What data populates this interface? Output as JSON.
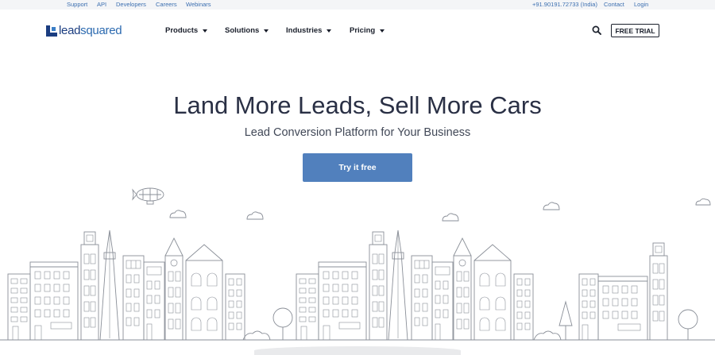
{
  "topbar": {
    "links_left": [
      "Support",
      "API",
      "Developers",
      "Careers",
      "Webinars"
    ],
    "phone": "+91.90191.72733 (India)",
    "contact": "Contact",
    "login": "Login"
  },
  "brand": {
    "name_part1": "lead",
    "name_part2": "squared"
  },
  "nav": {
    "items": [
      {
        "label": "Products"
      },
      {
        "label": "Solutions"
      },
      {
        "label": "Industries"
      },
      {
        "label": "Pricing"
      }
    ],
    "free_trial_label": "FREE TRIAL"
  },
  "hero": {
    "title": "Land More Leads, Sell More Cars",
    "subtitle": "Lead Conversion Platform for Your Business",
    "cta_label": "Try it free"
  },
  "icons": {
    "search": "search-icon",
    "dropdown": "caret-down-icon",
    "illustration": "city-skyline-illustration"
  },
  "colors": {
    "link_blue": "#3c6fb0",
    "brand_navy": "#1b3d80",
    "cta_blue": "#5180bd",
    "line_art": "#8a8f98"
  }
}
